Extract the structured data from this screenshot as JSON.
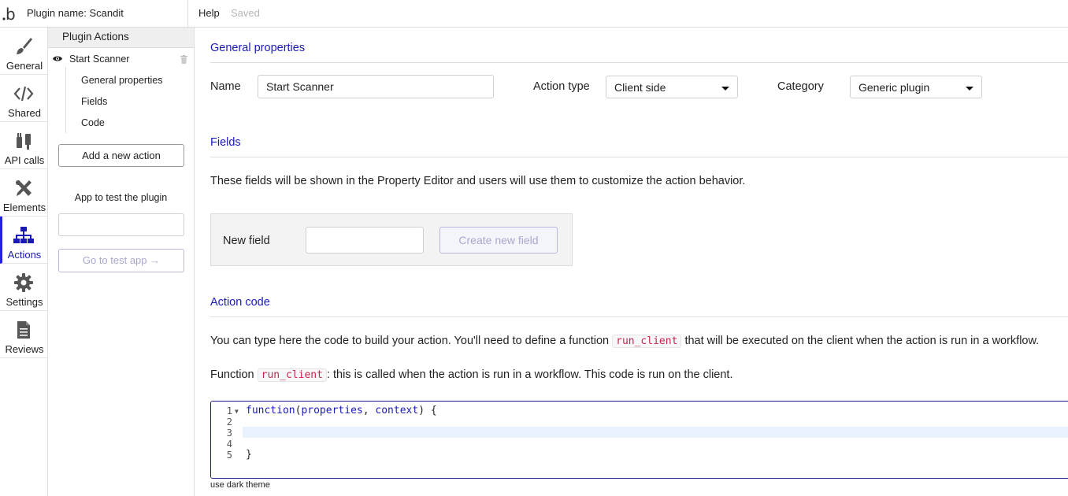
{
  "topbar": {
    "logo_glyph": "b",
    "plugin_name": "Plugin name: Scandit",
    "help": "Help",
    "saved": "Saved"
  },
  "rail": {
    "items": [
      {
        "label": "General",
        "icon": "brush-icon"
      },
      {
        "label": "Shared",
        "icon": "code-icon"
      },
      {
        "label": "API calls",
        "icon": "plug-icon"
      },
      {
        "label": "Elements",
        "icon": "tools-icon"
      },
      {
        "label": "Actions",
        "icon": "sitemap-icon",
        "active": true
      },
      {
        "label": "Settings",
        "icon": "gear-icon"
      },
      {
        "label": "Reviews",
        "icon": "document-icon"
      }
    ],
    "accent": "#2323d6"
  },
  "sidebar": {
    "header": "Plugin Actions",
    "action_name": "Start Scanner",
    "sub_items": [
      "General properties",
      "Fields",
      "Code"
    ],
    "add_action": "Add a new action",
    "test_label": "App to test the plugin",
    "test_input_value": "",
    "goto_test": "Go to test app →"
  },
  "general": {
    "title": "General properties",
    "name_label": "Name",
    "name_value": "Start Scanner",
    "action_type_label": "Action type",
    "action_type_value": "Client side",
    "category_label": "Category",
    "category_value": "Generic plugin"
  },
  "fields": {
    "title": "Fields",
    "description": "These fields will be shown in the Property Editor and users will use them to customize the action behavior.",
    "new_field_label": "New field",
    "new_field_value": "",
    "create_button": "Create new field"
  },
  "action_code": {
    "title": "Action code",
    "intro_before": "You can type here the code to build your action. You'll need to define a function",
    "intro_code": "run_client",
    "intro_after": "that will be executed on the client when the action is run in a workflow.",
    "fn_before": "Function",
    "fn_code": "run_client",
    "fn_after": ": this is called when the action is run in a workflow. This code is run on the client.",
    "line_numbers": [
      "1",
      "2",
      "3",
      "4",
      "5"
    ],
    "code_lines": {
      "l1_kw": "function",
      "l1_open": "(",
      "l1_p1": "properties",
      "l1_comma": ", ",
      "l1_p2": "context",
      "l1_close": ") {",
      "l5": "}"
    },
    "dark_theme": "use dark theme"
  },
  "colors": {
    "section_title": "#1a1ab8",
    "inline_code": "#c7254e",
    "disabled_button_text": "#a8a8cf"
  }
}
